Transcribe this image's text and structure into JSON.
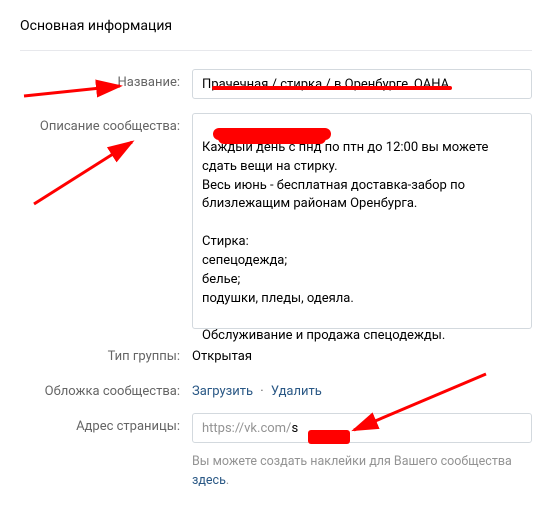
{
  "header": {
    "title": "Основная информация"
  },
  "form": {
    "name": {
      "label": "Название:",
      "value": "Прачечная / стирка / в Оренбурге, ОАНА"
    },
    "description": {
      "label": "Описание сообщества:",
      "value_line1_redacted": "",
      "value_rest": "Каждый день с пнд по птн до 12:00 вы можете сдать вещи на стирку.\nВесь июнь - бесплатная доставка-забор по близлежащим районам Оренбурга.\n\nСтирка:\nсепецодежда;\nбелье;\nподушки, пледы, одеяла.\n\nОбслуживание и продажа спецодежды."
    },
    "group_type": {
      "label": "Тип группы:",
      "value": "Открытая"
    },
    "cover": {
      "label": "Обложка сообщества:",
      "upload": "Загрузить",
      "separator": "·",
      "delete": "Удалить"
    },
    "address": {
      "label": "Адрес страницы:",
      "prefix": "https://vk.com/",
      "value": "s",
      "hint_text": "Вы можете создать наклейки для Вашего сообщества ",
      "hint_link": "здесь",
      "hint_period": "."
    }
  }
}
